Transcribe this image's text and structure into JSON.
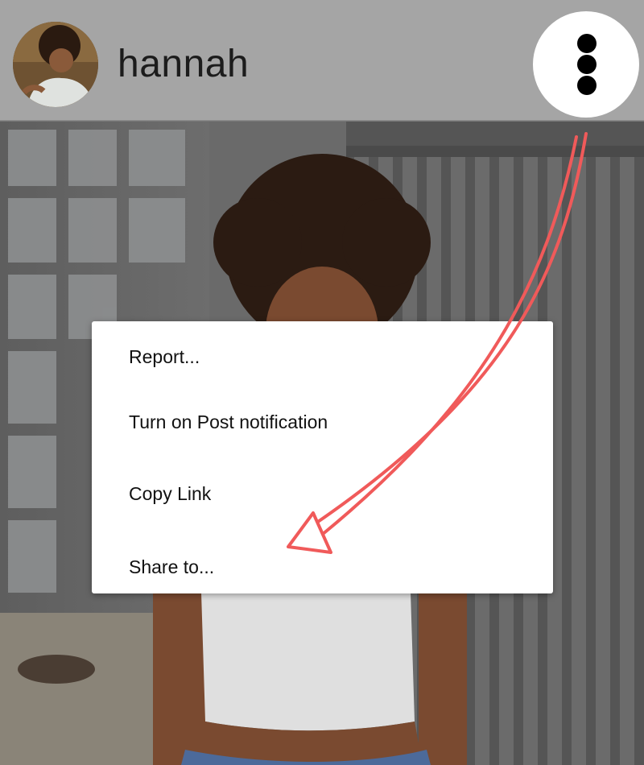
{
  "header": {
    "username": "hannah",
    "avatar_icon": "profile-photo",
    "more_icon": "more-vertical-icon"
  },
  "menu": {
    "items": [
      {
        "label": "Report..."
      },
      {
        "label": "Turn on Post notification"
      },
      {
        "label": "Copy Link"
      },
      {
        "label": "Share to..."
      }
    ]
  },
  "colors": {
    "header_bg": "#a5a5a5",
    "annotation_arrow": "#f05a5a",
    "menu_bg": "#ffffff"
  }
}
